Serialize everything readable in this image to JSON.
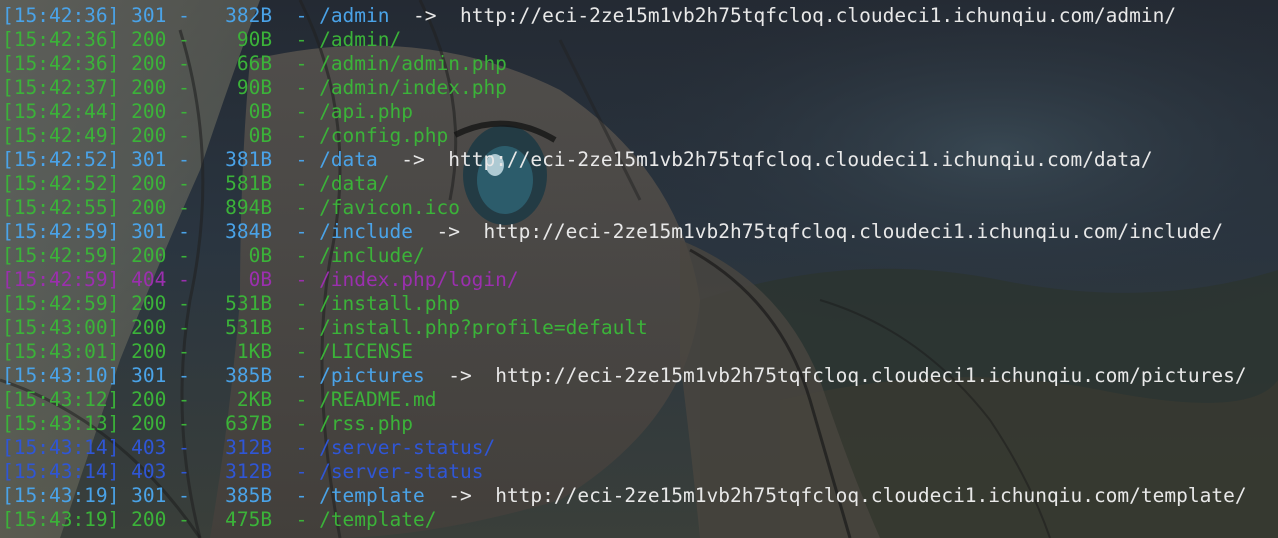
{
  "terminal": {
    "lines": [
      {
        "time": "[15:42:36]",
        "status": "301",
        "size": "382B",
        "path": "/admin",
        "redirect": "http://eci-2ze15m1vb2h75tqfcloq.cloudeci1.ichunqiu.com/admin/"
      },
      {
        "time": "[15:42:36]",
        "status": "200",
        "size": "90B",
        "path": "/admin/",
        "redirect": ""
      },
      {
        "time": "[15:42:36]",
        "status": "200",
        "size": "66B",
        "path": "/admin/admin.php",
        "redirect": ""
      },
      {
        "time": "[15:42:37]",
        "status": "200",
        "size": "90B",
        "path": "/admin/index.php",
        "redirect": ""
      },
      {
        "time": "[15:42:44]",
        "status": "200",
        "size": "0B",
        "path": "/api.php",
        "redirect": ""
      },
      {
        "time": "[15:42:49]",
        "status": "200",
        "size": "0B",
        "path": "/config.php",
        "redirect": ""
      },
      {
        "time": "[15:42:52]",
        "status": "301",
        "size": "381B",
        "path": "/data",
        "redirect": "http://eci-2ze15m1vb2h75tqfcloq.cloudeci1.ichunqiu.com/data/"
      },
      {
        "time": "[15:42:52]",
        "status": "200",
        "size": "581B",
        "path": "/data/",
        "redirect": ""
      },
      {
        "time": "[15:42:55]",
        "status": "200",
        "size": "894B",
        "path": "/favicon.ico",
        "redirect": ""
      },
      {
        "time": "[15:42:59]",
        "status": "301",
        "size": "384B",
        "path": "/include",
        "redirect": "http://eci-2ze15m1vb2h75tqfcloq.cloudeci1.ichunqiu.com/include/"
      },
      {
        "time": "[15:42:59]",
        "status": "200",
        "size": "0B",
        "path": "/include/",
        "redirect": ""
      },
      {
        "time": "[15:42:59]",
        "status": "404",
        "size": "0B",
        "path": "/index.php/login/",
        "redirect": ""
      },
      {
        "time": "[15:42:59]",
        "status": "200",
        "size": "531B",
        "path": "/install.php",
        "redirect": ""
      },
      {
        "time": "[15:43:00]",
        "status": "200",
        "size": "531B",
        "path": "/install.php?profile=default",
        "redirect": ""
      },
      {
        "time": "[15:43:01]",
        "status": "200",
        "size": "1KB",
        "path": "/LICENSE",
        "redirect": ""
      },
      {
        "time": "[15:43:10]",
        "status": "301",
        "size": "385B",
        "path": "/pictures",
        "redirect": "http://eci-2ze15m1vb2h75tqfcloq.cloudeci1.ichunqiu.com/pictures/"
      },
      {
        "time": "[15:43:12]",
        "status": "200",
        "size": "2KB",
        "path": "/README.md",
        "redirect": ""
      },
      {
        "time": "[15:43:13]",
        "status": "200",
        "size": "637B",
        "path": "/rss.php",
        "redirect": ""
      },
      {
        "time": "[15:43:14]",
        "status": "403",
        "size": "312B",
        "path": "/server-status/",
        "redirect": ""
      },
      {
        "time": "[15:43:14]",
        "status": "403",
        "size": "312B",
        "path": "/server-status",
        "redirect": ""
      },
      {
        "time": "[15:43:19]",
        "status": "301",
        "size": "385B",
        "path": "/template",
        "redirect": "http://eci-2ze15m1vb2h75tqfcloq.cloudeci1.ichunqiu.com/template/"
      },
      {
        "time": "[15:43:19]",
        "status": "200",
        "size": "475B",
        "path": "/template/",
        "redirect": ""
      }
    ],
    "separator": "-",
    "arrow": "->"
  },
  "colors": {
    "status_200": "#3bb339",
    "status_301": "#4aa3e8",
    "status_403": "#2f56d6",
    "status_404": "#9b2fae",
    "redirect_url": "#e8e8e8",
    "background": "#1e2530"
  },
  "background_image": "anime-character-wallpaper"
}
